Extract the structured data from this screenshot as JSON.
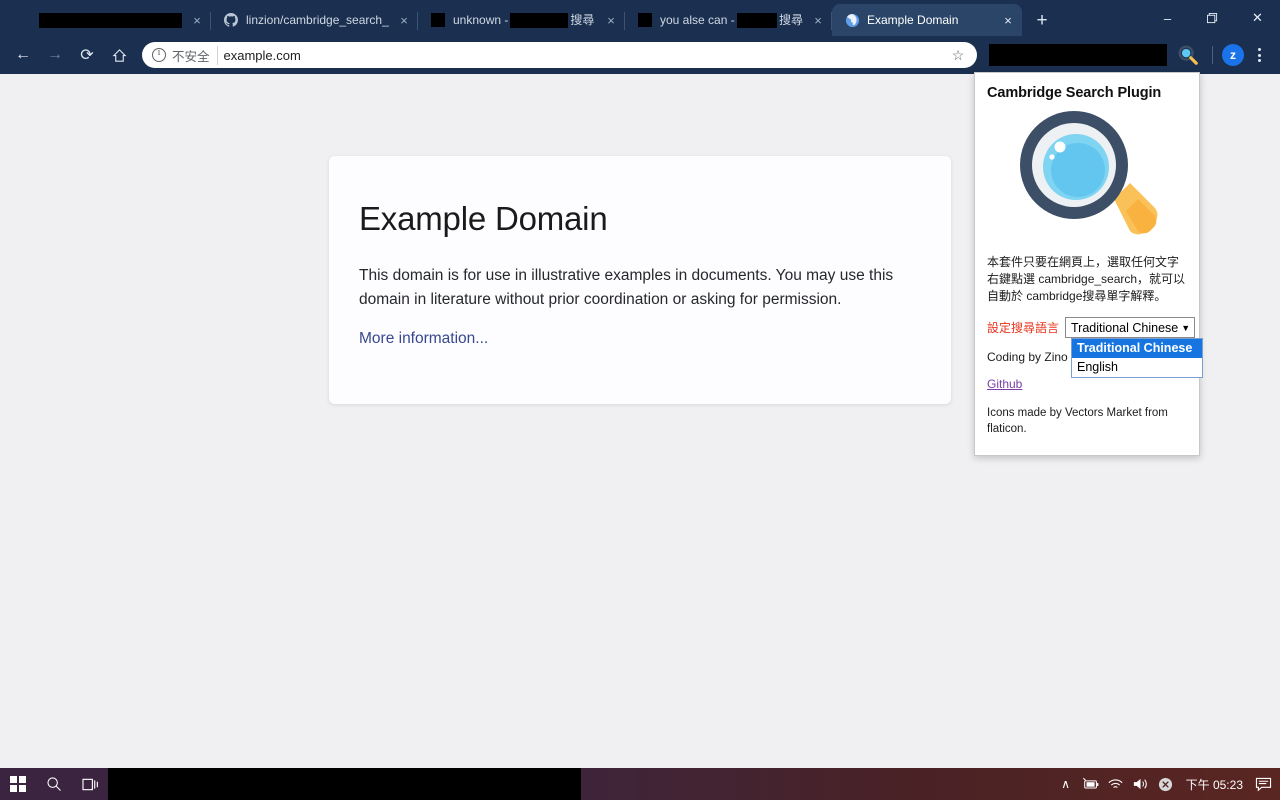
{
  "browser": {
    "tabs": [
      {
        "title": "",
        "redacted": true,
        "redact_width": 170,
        "favicon": "blank-icon",
        "active": false,
        "close_label": "×"
      },
      {
        "title": "linzion/cambridge_search_pl",
        "redacted": false,
        "favicon": "github-icon",
        "active": false,
        "close_label": "×"
      },
      {
        "title_before": "unknown - ",
        "title_after": "搜尋",
        "redacted": true,
        "redact_width": 58,
        "favicon": "redacted-favicon",
        "active": false,
        "close_label": "×"
      },
      {
        "title_before": "you alse can - ",
        "title_after": "搜尋",
        "redacted": true,
        "redact_width": 58,
        "favicon": "redacted-favicon",
        "active": false,
        "close_label": "×"
      },
      {
        "title": "Example Domain",
        "redacted": false,
        "favicon": "globe-icon",
        "active": true,
        "close_label": "×"
      }
    ],
    "new_tab_label": "+",
    "window_controls": {
      "minimize": "–",
      "maximize": "❐",
      "close": "✕"
    },
    "toolbar": {
      "back_label": "←",
      "forward_label": "→",
      "reload_label": "⟳",
      "home_label": "⌂",
      "security_text": "不安全",
      "url": "example.com",
      "bookmark_label": "☆",
      "extension_icon": "magnifier-extension-icon",
      "profile_initial": "z",
      "menu_label": "kebab-menu-icon"
    }
  },
  "page": {
    "title": "Example Domain",
    "paragraph": "This domain is for use in illustrative examples in documents. You may use this domain in literature without prior coordination or asking for permission.",
    "more_link": "More information..."
  },
  "popup": {
    "title": "Cambridge Search Plugin",
    "icon": "magnifying-glass-icon",
    "description": "本套件只要在網頁上，選取任何文字右鍵點選 cambridge_search，就可以自動於 cambridge搜尋單字解釋。",
    "language_label": "設定搜尋語言",
    "language_selected": "Traditional Chinese",
    "language_caret": "▼",
    "language_options": [
      {
        "label": "Traditional Chinese",
        "selected": true
      },
      {
        "label": "English",
        "selected": false
      }
    ],
    "credit": "Coding by Zino",
    "github_link": "Github",
    "attribution": "Icons made by Vectors Market from flaticon."
  },
  "taskbar": {
    "start_label": "windows-start-icon",
    "search_label": "search-icon",
    "taskview_label": "task-view-icon",
    "tray": {
      "chevron": "∧",
      "battery": "battery-icon",
      "wifi": "wifi-icon",
      "volume": "volume-icon",
      "alert": "✕",
      "clock": "下午 05:23",
      "action_center": "action-center-icon"
    }
  },
  "colors": {
    "chrome_bg": "#1b3050",
    "active_tab": "#2b4568",
    "accent_blue": "#1a73e8",
    "option_highlight": "#1675e0",
    "label_red": "#e8341c",
    "link_purple": "#7a3fa8"
  }
}
